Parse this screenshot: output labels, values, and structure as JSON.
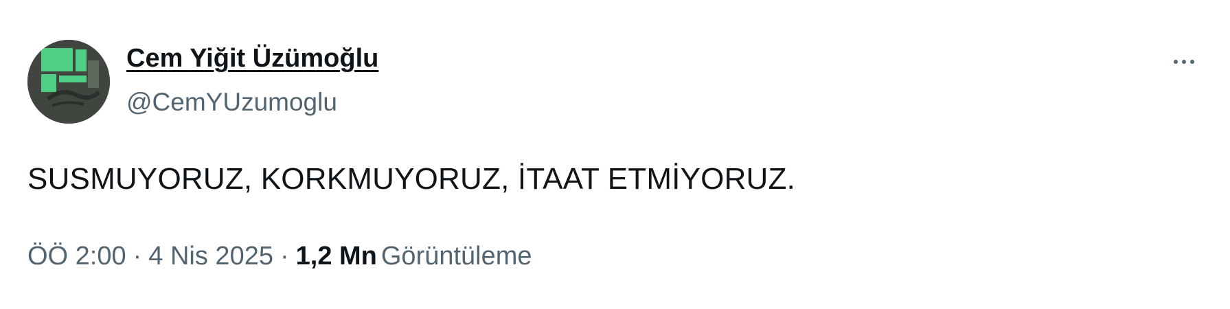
{
  "author": {
    "name": "Cem Yiğit Üzümoğlu",
    "handle": "@CemYUzumoglu"
  },
  "tweet": {
    "text": "SUSMUYORUZ, KORKMUYORUZ, İTAAT ETMİYORUZ."
  },
  "meta": {
    "time": "ÖÖ 2:00",
    "separator": "·",
    "date": "4 Nis 2025",
    "views_count": "1,2 Mn",
    "views_label": "Görüntüleme"
  },
  "icons": {
    "more": "more-horizontal-icon",
    "avatar": "avatar-image"
  },
  "colors": {
    "primary_text": "#0f1419",
    "secondary_text": "#536471",
    "avatar_green": "#4fcf86",
    "avatar_bg": "#3f4640"
  }
}
